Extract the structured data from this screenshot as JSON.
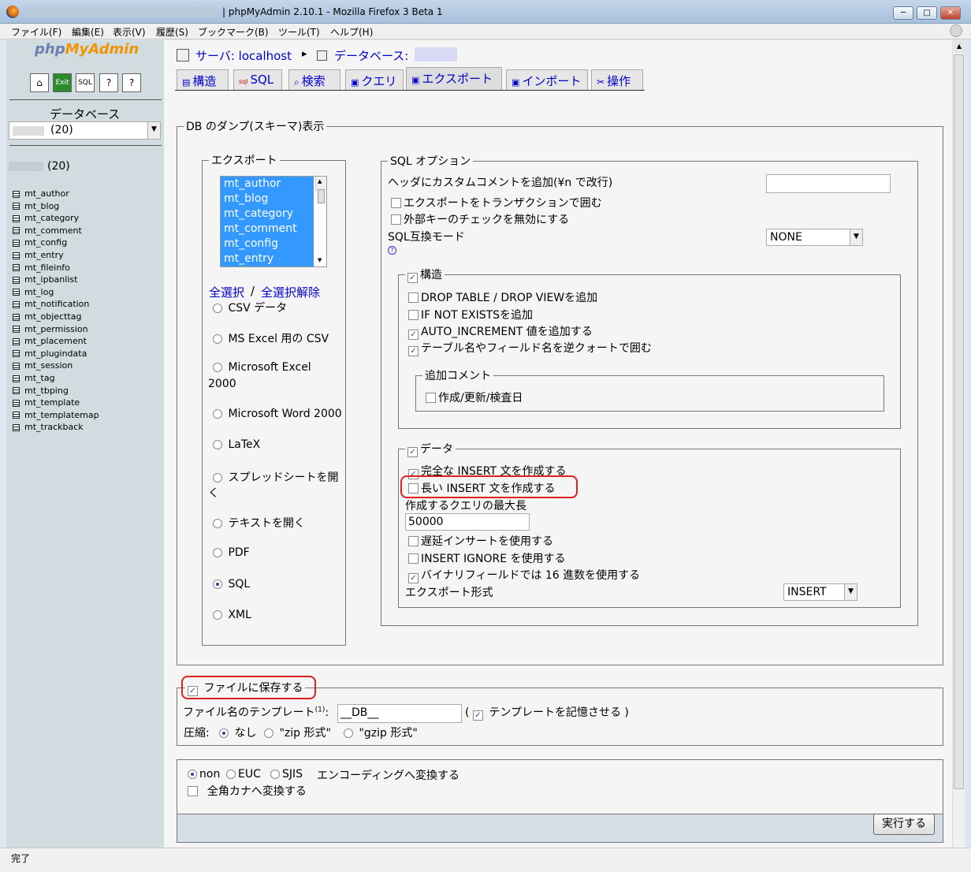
{
  "window": {
    "title": "| phpMyAdmin 2.10.1 - Mozilla Firefox 3 Beta 1",
    "minimize": "─",
    "maximize": "□",
    "close": "✕"
  },
  "menu": [
    "ファイル(F)",
    "編集(E)",
    "表示(V)",
    "履歴(S)",
    "ブックマーク(B)",
    "ツール(T)",
    "ヘルプ(H)"
  ],
  "nav": {
    "logo_php": "php",
    "logo_myadmin": "MyAdmin",
    "db_label": "データベース",
    "db_select": "(20)",
    "db_count": "(20)",
    "tables": [
      "mt_author",
      "mt_blog",
      "mt_category",
      "mt_comment",
      "mt_config",
      "mt_entry",
      "mt_fileinfo",
      "mt_ipbanlist",
      "mt_log",
      "mt_notification",
      "mt_objecttag",
      "mt_permission",
      "mt_placement",
      "mt_plugindata",
      "mt_session",
      "mt_tag",
      "mt_tbping",
      "mt_template",
      "mt_templatemap",
      "mt_trackback"
    ]
  },
  "breadcrumb": {
    "server": "サーバ: localhost",
    "arrow": "▸",
    "database": "データベース:"
  },
  "tabs": [
    "構造",
    "SQL",
    "検索",
    "クエリ",
    "エクスポート",
    "インポート",
    "操作"
  ],
  "dump": {
    "legend": "DB のダンプ(スキーマ)表示",
    "export": {
      "legend": "エクスポート",
      "list": [
        "mt_author",
        "mt_blog",
        "mt_category",
        "mt_comment",
        "mt_config",
        "mt_entry"
      ],
      "select_all": "全選択",
      "separator": "/",
      "deselect_all": "全選択解除",
      "formats": [
        "CSV データ",
        "MS Excel 用の CSV",
        "Microsoft Excel",
        "2000",
        "Microsoft Word 2000",
        "LaTeX",
        "スプレッドシートを開",
        "く",
        "テキストを開く",
        "PDF",
        "SQL",
        "XML"
      ]
    },
    "sql": {
      "legend": "SQL オプション",
      "header_comment": "ヘッダにカスタムコメントを追加(¥n で改行)",
      "transaction": "エクスポートをトランザクションで囲む",
      "disable_fk": "外部キーのチェックを無効にする",
      "compat_mode": "SQL互換モード",
      "compat_value": "NONE",
      "help": "?",
      "structure": {
        "legend": "構造",
        "drop": "DROP TABLE / DROP VIEWを追加",
        "if_not_exists": "IF NOT EXISTSを追加",
        "auto_increment": "AUTO_INCREMENT 値を追加する",
        "backquotes": "テーブル名やフィールド名を逆クォートで囲む",
        "comments_legend": "追加コメント",
        "dates": "作成/更新/検査日"
      },
      "data": {
        "legend": "データ",
        "complete_insert": "完全な INSERT 文を作成する",
        "extended_insert": "長い INSERT 文を作成する",
        "max_query": "作成するクエリの最大長",
        "max_query_value": "50000",
        "delayed": "遅延インサートを使用する",
        "ignore": "INSERT IGNORE を使用する",
        "hex": "バイナリフィールドでは 16 進数を使用する",
        "export_type": "エクスポート形式",
        "export_type_value": "INSERT"
      }
    }
  },
  "save": {
    "legend": "ファイルに保存する",
    "template_label": "ファイル名のテンプレート",
    "template_sup": "(1)",
    "template_colon": ":",
    "template_value": "__DB__",
    "paren_open": "(",
    "remember": "テンプレートを記憶させる",
    "paren_close": ")",
    "compression": "圧縮:",
    "none": "なし",
    "zip": "\"zip 形式\"",
    "gzip": "\"gzip 形式\""
  },
  "encoding": {
    "non": "non",
    "euc": "EUC",
    "sjis": "SJIS",
    "convert": "エンコーディングへ変換する",
    "kana": "全角カナへ変換する"
  },
  "go": "実行する",
  "status": "完了"
}
